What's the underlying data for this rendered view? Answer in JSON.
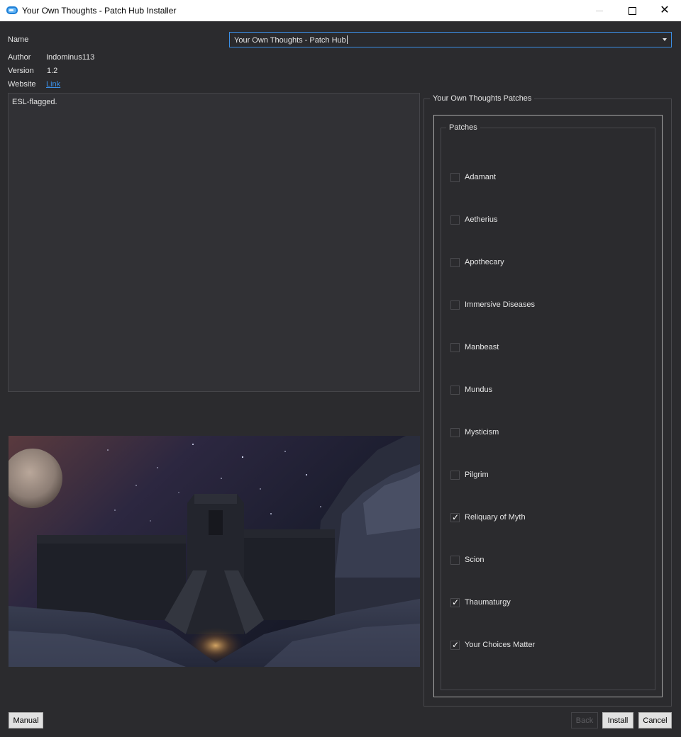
{
  "window": {
    "title": "Your Own Thoughts - Patch Hub Installer",
    "minimize_icon": "minimize-icon",
    "maximize_icon": "maximize-icon",
    "close_icon": "close-icon",
    "close_glyph": "✕"
  },
  "info": {
    "name_label": "Name",
    "name_value": "Your Own Thoughts - Patch Hub",
    "author_label": "Author",
    "author_value": "Indominus113",
    "version_label": "Version",
    "version_value": "1.2",
    "website_label": "Website",
    "website_value": "Link"
  },
  "description": {
    "text": "ESL-flagged."
  },
  "patches_panel": {
    "outer_title": "Your Own Thoughts Patches",
    "group_title": "Patches",
    "items": [
      {
        "label": "Adamant",
        "checked": false
      },
      {
        "label": "Aetherius",
        "checked": false
      },
      {
        "label": "Apothecary",
        "checked": false
      },
      {
        "label": "Immersive Diseases",
        "checked": false
      },
      {
        "label": "Manbeast",
        "checked": false
      },
      {
        "label": "Mundus",
        "checked": false
      },
      {
        "label": "Mysticism",
        "checked": false
      },
      {
        "label": "Pilgrim",
        "checked": false
      },
      {
        "label": "Reliquary of Myth",
        "checked": true
      },
      {
        "label": "Scion",
        "checked": false
      },
      {
        "label": "Thaumaturgy",
        "checked": true
      },
      {
        "label": "Your Choices Matter",
        "checked": true
      }
    ],
    "check_glyph": "✓"
  },
  "buttons": {
    "manual": "Manual",
    "back": "Back",
    "install": "Install",
    "cancel": "Cancel"
  },
  "colors": {
    "background": "#2b2b2e",
    "accent": "#3b8fe6",
    "titlebar": "#ffffff"
  }
}
